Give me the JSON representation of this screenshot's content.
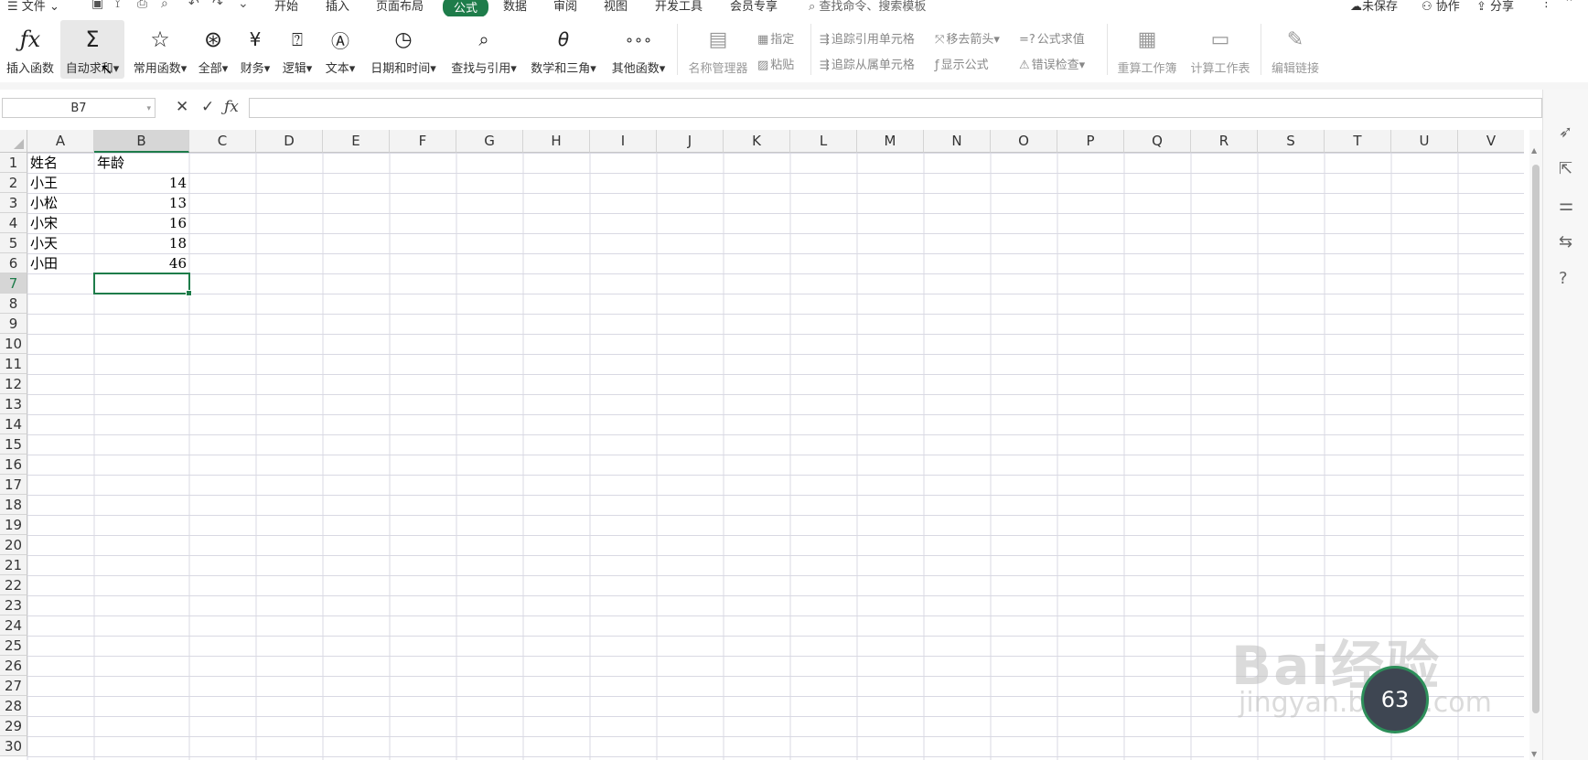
{
  "menu": {
    "file": "文件",
    "tabs": [
      "开始",
      "插入",
      "页面布局",
      "公式",
      "数据",
      "审阅",
      "视图",
      "开发工具",
      "会员专享"
    ],
    "search": "查找命令、搜索模板",
    "unsaved": "未保存",
    "collab": "协作",
    "share": "分享"
  },
  "ribbon": {
    "insert_func": "插入函数",
    "autosum": "自动求和",
    "common": "常用函数",
    "all": "全部",
    "finance": "财务",
    "logic": "逻辑",
    "text": "文本",
    "datetime": "日期和时间",
    "lookup": "查找与引用",
    "math": "数学和三角",
    "other": "其他函数",
    "name_mgr": "名称管理器",
    "assign": "指定",
    "paste": "粘贴",
    "trace_prec": "追踪引用单元格",
    "trace_dep": "追踪从属单元格",
    "remove_arrows": "移去箭头",
    "show_formula": "显示公式",
    "eval_formula": "公式求值",
    "error_check": "错误检查",
    "recalc_book": "重算工作簿",
    "calc_sheet": "计算工作表",
    "edit_links": "编辑链接"
  },
  "formula_bar": {
    "name_box": "B7",
    "formula": ""
  },
  "sheet": {
    "columns": [
      "A",
      "B",
      "C",
      "D",
      "E",
      "F",
      "G",
      "H",
      "I",
      "J",
      "K",
      "L",
      "M",
      "N",
      "O",
      "P",
      "Q",
      "R",
      "S",
      "T",
      "U",
      "V"
    ],
    "rows": [
      "1",
      "2",
      "3",
      "4",
      "5",
      "6",
      "7",
      "8",
      "9",
      "10",
      "11",
      "12",
      "13",
      "14",
      "15",
      "16",
      "17",
      "18",
      "19",
      "20",
      "21",
      "22",
      "23",
      "24",
      "25",
      "26",
      "27",
      "28",
      "29",
      "30"
    ],
    "header": [
      "姓名",
      "年龄"
    ],
    "data": [
      [
        "小王",
        "14"
      ],
      [
        "小松",
        "13"
      ],
      [
        "小宋",
        "16"
      ],
      [
        "小天",
        "18"
      ],
      [
        "小田",
        "46"
      ]
    ],
    "selected_col": "B",
    "selected_row": "7"
  },
  "watermark": {
    "line1": "Bai经验",
    "line2": "jingyan.baidu.com"
  },
  "badge": "63",
  "colors": {
    "accent": "#1e7c4a"
  }
}
